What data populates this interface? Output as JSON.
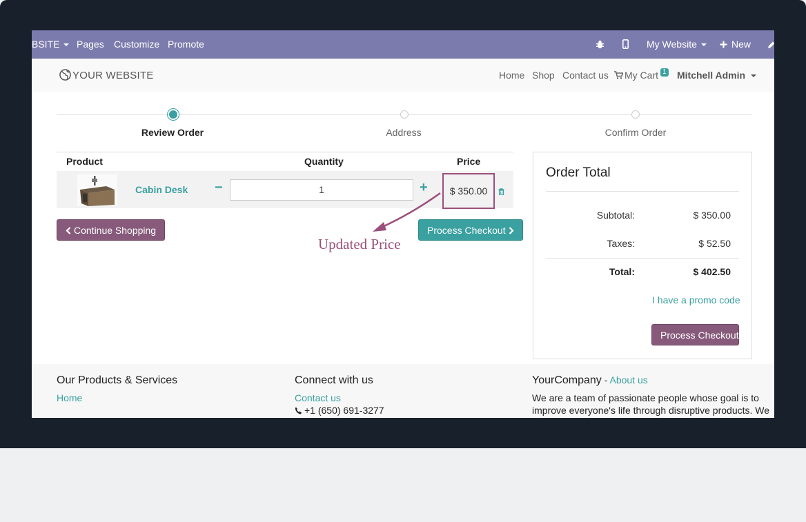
{
  "topbar": {
    "items": [
      "BSITE",
      "Pages",
      "Customize",
      "Promote"
    ],
    "website_label": "My Website",
    "new_label": "New"
  },
  "header": {
    "logo": "YOUR WEBSITE",
    "nav": [
      "Home",
      "Shop",
      "Contact us"
    ],
    "cart_label": "My Cart",
    "cart_count": "1",
    "user": "Mitchell Admin"
  },
  "wizard": {
    "steps": [
      "Review Order",
      "Address",
      "Confirm Order"
    ],
    "active": 0
  },
  "cart": {
    "headers": {
      "product": "Product",
      "quantity": "Quantity",
      "price": "Price"
    },
    "items": [
      {
        "name": "Cabin Desk",
        "quantity": "1",
        "price": "$ 350.00"
      }
    ]
  },
  "buttons": {
    "continue": "Continue Shopping",
    "checkout": "Process Checkout"
  },
  "annotation": "Updated Price",
  "order_total": {
    "title": "Order Total",
    "subtotal_label": "Subtotal:",
    "subtotal": "$ 350.00",
    "taxes_label": "Taxes:",
    "taxes": "$ 52.50",
    "total_label": "Total:",
    "total": "$ 402.50",
    "promo": "I have a promo code",
    "checkout": "Process Checkout"
  },
  "footer": {
    "col1": {
      "title": "Our Products & Services",
      "link": "Home"
    },
    "col2": {
      "title": "Connect with us",
      "link": "Contact us",
      "phone": "+1 (650) 691-3277"
    },
    "col3": {
      "title": "YourCompany",
      "sep": " - ",
      "link": "About us",
      "line1": "We are a team of passionate people whose goal is to",
      "line2": "improve everyone's life through disruptive products. We"
    }
  },
  "colors": {
    "topbar": "#7c7bad",
    "teal": "#3aa0a0",
    "purple": "#875a7b",
    "annotation": "#9c4f7c"
  }
}
